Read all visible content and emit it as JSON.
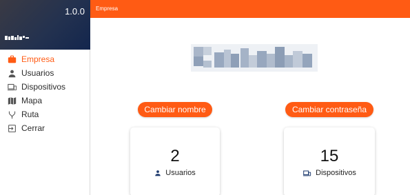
{
  "sidebar": {
    "version": "1.0.0",
    "items": [
      {
        "label": "Empresa",
        "icon": "briefcase-icon",
        "active": true
      },
      {
        "label": "Usuarios",
        "icon": "person-icon"
      },
      {
        "label": "Dispositivos",
        "icon": "devices-icon"
      },
      {
        "label": "Mapa",
        "icon": "map-icon"
      },
      {
        "label": "Ruta",
        "icon": "route-icon"
      },
      {
        "label": "Cerrar",
        "icon": "logout-icon"
      }
    ]
  },
  "topbar": {
    "title": "Empresa"
  },
  "actions": {
    "rename_label": "Cambiar nombre",
    "password_label": "Cambiar contraseña"
  },
  "stats": {
    "users": {
      "value": "2",
      "label": "Usuarios",
      "icon": "person-icon"
    },
    "devices": {
      "value": "15",
      "label": "Dispositivos",
      "icon": "devices-icon"
    }
  },
  "colors": {
    "accent": "#ff5b14",
    "sidebar_header": "#1e2f52",
    "text": "#222222"
  }
}
